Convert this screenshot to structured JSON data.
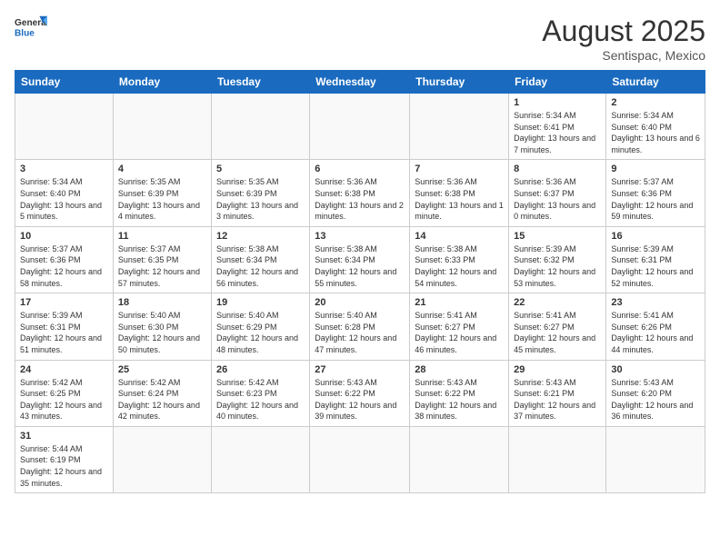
{
  "header": {
    "logo_general": "General",
    "logo_blue": "Blue",
    "month_title": "August 2025",
    "subtitle": "Sentispac, Mexico"
  },
  "days_of_week": [
    "Sunday",
    "Monday",
    "Tuesday",
    "Wednesday",
    "Thursday",
    "Friday",
    "Saturday"
  ],
  "weeks": [
    [
      {
        "day": "",
        "info": ""
      },
      {
        "day": "",
        "info": ""
      },
      {
        "day": "",
        "info": ""
      },
      {
        "day": "",
        "info": ""
      },
      {
        "day": "",
        "info": ""
      },
      {
        "day": "1",
        "info": "Sunrise: 5:34 AM\nSunset: 6:41 PM\nDaylight: 13 hours and 7 minutes."
      },
      {
        "day": "2",
        "info": "Sunrise: 5:34 AM\nSunset: 6:40 PM\nDaylight: 13 hours and 6 minutes."
      }
    ],
    [
      {
        "day": "3",
        "info": "Sunrise: 5:34 AM\nSunset: 6:40 PM\nDaylight: 13 hours and 5 minutes."
      },
      {
        "day": "4",
        "info": "Sunrise: 5:35 AM\nSunset: 6:39 PM\nDaylight: 13 hours and 4 minutes."
      },
      {
        "day": "5",
        "info": "Sunrise: 5:35 AM\nSunset: 6:39 PM\nDaylight: 13 hours and 3 minutes."
      },
      {
        "day": "6",
        "info": "Sunrise: 5:36 AM\nSunset: 6:38 PM\nDaylight: 13 hours and 2 minutes."
      },
      {
        "day": "7",
        "info": "Sunrise: 5:36 AM\nSunset: 6:38 PM\nDaylight: 13 hours and 1 minute."
      },
      {
        "day": "8",
        "info": "Sunrise: 5:36 AM\nSunset: 6:37 PM\nDaylight: 13 hours and 0 minutes."
      },
      {
        "day": "9",
        "info": "Sunrise: 5:37 AM\nSunset: 6:36 PM\nDaylight: 12 hours and 59 minutes."
      }
    ],
    [
      {
        "day": "10",
        "info": "Sunrise: 5:37 AM\nSunset: 6:36 PM\nDaylight: 12 hours and 58 minutes."
      },
      {
        "day": "11",
        "info": "Sunrise: 5:37 AM\nSunset: 6:35 PM\nDaylight: 12 hours and 57 minutes."
      },
      {
        "day": "12",
        "info": "Sunrise: 5:38 AM\nSunset: 6:34 PM\nDaylight: 12 hours and 56 minutes."
      },
      {
        "day": "13",
        "info": "Sunrise: 5:38 AM\nSunset: 6:34 PM\nDaylight: 12 hours and 55 minutes."
      },
      {
        "day": "14",
        "info": "Sunrise: 5:38 AM\nSunset: 6:33 PM\nDaylight: 12 hours and 54 minutes."
      },
      {
        "day": "15",
        "info": "Sunrise: 5:39 AM\nSunset: 6:32 PM\nDaylight: 12 hours and 53 minutes."
      },
      {
        "day": "16",
        "info": "Sunrise: 5:39 AM\nSunset: 6:31 PM\nDaylight: 12 hours and 52 minutes."
      }
    ],
    [
      {
        "day": "17",
        "info": "Sunrise: 5:39 AM\nSunset: 6:31 PM\nDaylight: 12 hours and 51 minutes."
      },
      {
        "day": "18",
        "info": "Sunrise: 5:40 AM\nSunset: 6:30 PM\nDaylight: 12 hours and 50 minutes."
      },
      {
        "day": "19",
        "info": "Sunrise: 5:40 AM\nSunset: 6:29 PM\nDaylight: 12 hours and 48 minutes."
      },
      {
        "day": "20",
        "info": "Sunrise: 5:40 AM\nSunset: 6:28 PM\nDaylight: 12 hours and 47 minutes."
      },
      {
        "day": "21",
        "info": "Sunrise: 5:41 AM\nSunset: 6:27 PM\nDaylight: 12 hours and 46 minutes."
      },
      {
        "day": "22",
        "info": "Sunrise: 5:41 AM\nSunset: 6:27 PM\nDaylight: 12 hours and 45 minutes."
      },
      {
        "day": "23",
        "info": "Sunrise: 5:41 AM\nSunset: 6:26 PM\nDaylight: 12 hours and 44 minutes."
      }
    ],
    [
      {
        "day": "24",
        "info": "Sunrise: 5:42 AM\nSunset: 6:25 PM\nDaylight: 12 hours and 43 minutes."
      },
      {
        "day": "25",
        "info": "Sunrise: 5:42 AM\nSunset: 6:24 PM\nDaylight: 12 hours and 42 minutes."
      },
      {
        "day": "26",
        "info": "Sunrise: 5:42 AM\nSunset: 6:23 PM\nDaylight: 12 hours and 40 minutes."
      },
      {
        "day": "27",
        "info": "Sunrise: 5:43 AM\nSunset: 6:22 PM\nDaylight: 12 hours and 39 minutes."
      },
      {
        "day": "28",
        "info": "Sunrise: 5:43 AM\nSunset: 6:22 PM\nDaylight: 12 hours and 38 minutes."
      },
      {
        "day": "29",
        "info": "Sunrise: 5:43 AM\nSunset: 6:21 PM\nDaylight: 12 hours and 37 minutes."
      },
      {
        "day": "30",
        "info": "Sunrise: 5:43 AM\nSunset: 6:20 PM\nDaylight: 12 hours and 36 minutes."
      }
    ],
    [
      {
        "day": "31",
        "info": "Sunrise: 5:44 AM\nSunset: 6:19 PM\nDaylight: 12 hours and 35 minutes."
      },
      {
        "day": "",
        "info": ""
      },
      {
        "day": "",
        "info": ""
      },
      {
        "day": "",
        "info": ""
      },
      {
        "day": "",
        "info": ""
      },
      {
        "day": "",
        "info": ""
      },
      {
        "day": "",
        "info": ""
      }
    ]
  ]
}
